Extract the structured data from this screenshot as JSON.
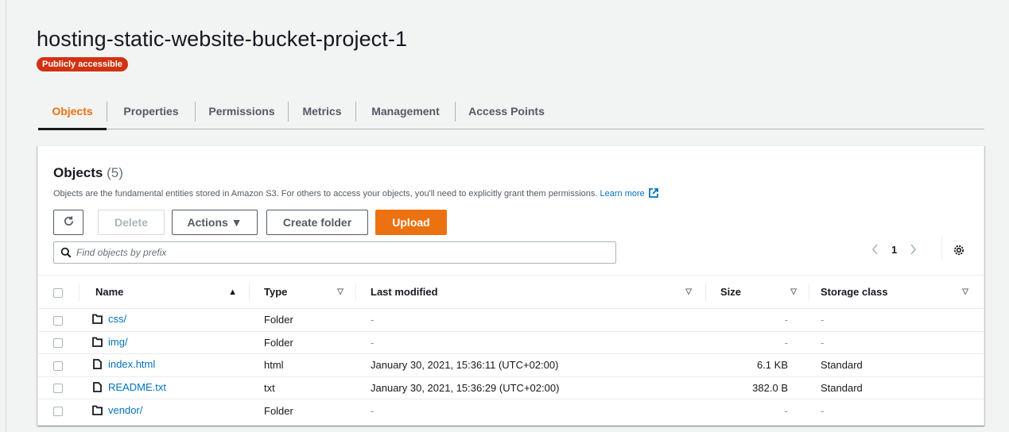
{
  "bucket": {
    "title": "hosting-static-website-bucket-project-1",
    "access_badge": "Publicly accessible"
  },
  "tabs": [
    {
      "label": "Objects",
      "active": true
    },
    {
      "label": "Properties",
      "active": false
    },
    {
      "label": "Permissions",
      "active": false
    },
    {
      "label": "Metrics",
      "active": false
    },
    {
      "label": "Management",
      "active": false
    },
    {
      "label": "Access Points",
      "active": false
    }
  ],
  "objects_panel": {
    "heading": "Objects",
    "count": "(5)",
    "description": "Objects are the fundamental entities stored in Amazon S3. For others to access your objects, you'll need to explicitly grant them permissions.",
    "learn_more": "Learn more",
    "toolbar": {
      "refresh_icon": "refresh-icon",
      "delete_label": "Delete",
      "actions_label": "Actions ▼",
      "create_folder_label": "Create folder",
      "upload_label": "Upload"
    },
    "search": {
      "placeholder": "Find objects by prefix",
      "value": ""
    },
    "pagination": {
      "current_page": "1"
    },
    "columns": {
      "name": "Name",
      "type": "Type",
      "last_modified": "Last modified",
      "size": "Size",
      "storage_class": "Storage class"
    },
    "rows": [
      {
        "name": "css/",
        "icon": "folder-icon",
        "type": "Folder",
        "last_modified": "-",
        "size": "-",
        "storage_class": "-"
      },
      {
        "name": "img/",
        "icon": "folder-icon",
        "type": "Folder",
        "last_modified": "-",
        "size": "-",
        "storage_class": "-"
      },
      {
        "name": "index.html",
        "icon": "file-icon",
        "type": "html",
        "last_modified": "January 30, 2021, 15:36:11 (UTC+02:00)",
        "size": "6.1 KB",
        "storage_class": "Standard"
      },
      {
        "name": "README.txt",
        "icon": "file-icon",
        "type": "txt",
        "last_modified": "January 30, 2021, 15:36:29 (UTC+02:00)",
        "size": "382.0 B",
        "storage_class": "Standard"
      },
      {
        "name": "vendor/",
        "icon": "folder-icon",
        "type": "Folder",
        "last_modified": "-",
        "size": "-",
        "storage_class": "-"
      }
    ]
  },
  "colors": {
    "accent_orange": "#ec7211",
    "badge_red": "#d13212",
    "link_blue": "#0073bb"
  }
}
